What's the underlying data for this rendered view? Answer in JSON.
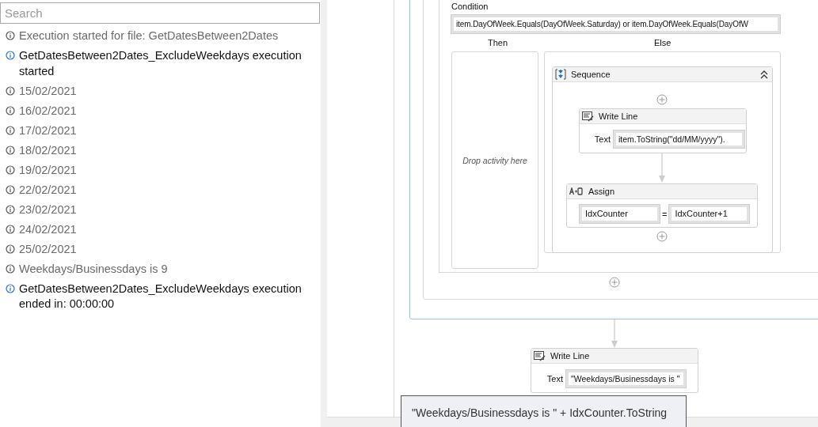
{
  "search": {
    "placeholder": "Search"
  },
  "log": [
    {
      "kind": "trace",
      "text": "Execution started for file: GetDatesBetween2Dates"
    },
    {
      "kind": "info",
      "text": "GetDatesBetween2Dates_ExcludeWeekdays execution started"
    },
    {
      "kind": "trace",
      "text": "15/02/2021"
    },
    {
      "kind": "trace",
      "text": "16/02/2021"
    },
    {
      "kind": "trace",
      "text": "17/02/2021"
    },
    {
      "kind": "trace",
      "text": "18/02/2021"
    },
    {
      "kind": "trace",
      "text": "19/02/2021"
    },
    {
      "kind": "trace",
      "text": "22/02/2021"
    },
    {
      "kind": "trace",
      "text": "23/02/2021"
    },
    {
      "kind": "trace",
      "text": "24/02/2021"
    },
    {
      "kind": "trace",
      "text": "25/02/2021"
    },
    {
      "kind": "trace",
      "text": "Weekdays/Businessdays is 9"
    },
    {
      "kind": "info",
      "text": "GetDatesBetween2Dates_ExcludeWeekdays execution ended in: 00:00:00"
    }
  ],
  "designer": {
    "condition": {
      "label": "Condition",
      "value": "item.DayOfWeek.Equals(DayOfWeek.Saturday) or  item.DayOfWeek.Equals(DayOfW"
    },
    "then": {
      "label": "Then",
      "hint": "Drop activity here"
    },
    "else": {
      "label": "Else"
    },
    "sequence": {
      "title": "Sequence",
      "expanded": true,
      "activities": [
        {
          "kind": "write_line",
          "title": "Write Line",
          "field_label": "Text",
          "value": "item.ToString(\"dd/MM/yyyy\")."
        },
        {
          "kind": "assign",
          "title": "Assign",
          "to": "IdxCounter",
          "operator": "=",
          "value": "IdxCounter+1"
        }
      ]
    },
    "after": {
      "kind": "write_line",
      "title": "Write Line",
      "field_label": "Text",
      "value": "\"Weekdays/Businessdays is \""
    },
    "tooltip": "\"Weekdays/Businessdays is \" + IdxCounter.ToString"
  }
}
